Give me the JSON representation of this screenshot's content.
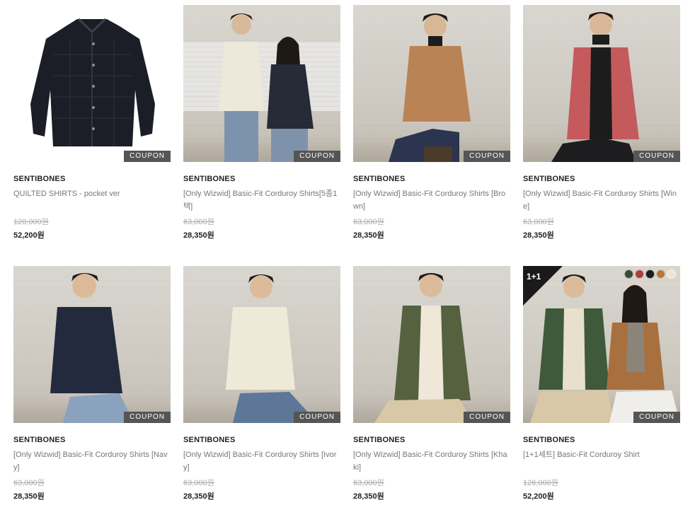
{
  "products": [
    {
      "brand": "SENTIBONES",
      "name": "QUILTED SHIRTS - pocket ver",
      "original_price": "120,000원",
      "sale_price": "52,200원",
      "coupon": "COUPON",
      "image": "quilted-shirt-flatlay",
      "colors": {
        "shirt": "#1b1e26"
      }
    },
    {
      "brand": "SENTIBONES",
      "name": "[Only Wizwid] Basic-Fit Corduroy Shirts[5종1택]",
      "original_price": "63,000원",
      "sale_price": "28,350원",
      "coupon": "COUPON",
      "image": "couple-models-photo",
      "colors": {
        "shirt": "#ece9da",
        "shirt2": "#262b38"
      }
    },
    {
      "brand": "SENTIBONES",
      "name": "[Only Wizwid] Basic-Fit Corduroy Shirts [Brown]",
      "original_price": "63,000원",
      "sale_price": "28,350원",
      "coupon": "COUPON",
      "image": "model-brown-shirt-photo",
      "colors": {
        "shirt": "#b98355"
      }
    },
    {
      "brand": "SENTIBONES",
      "name": "[Only Wizwid] Basic-Fit Corduroy Shirts [Wine]",
      "original_price": "63,000원",
      "sale_price": "28,350원",
      "coupon": "COUPON",
      "image": "model-wine-shirt-photo",
      "colors": {
        "shirt": "#c45a5c"
      }
    },
    {
      "brand": "SENTIBONES",
      "name": "[Only Wizwid] Basic-Fit Corduroy Shirts [Navy]",
      "original_price": "63,000원",
      "sale_price": "28,350원",
      "coupon": "COUPON",
      "image": "model-navy-shirt-photo",
      "colors": {
        "shirt": "#242a3d"
      }
    },
    {
      "brand": "SENTIBONES",
      "name": "[Only Wizwid] Basic-Fit Corduroy Shirts [Ivory]",
      "original_price": "63,000원",
      "sale_price": "28,350원",
      "coupon": "COUPON",
      "image": "model-ivory-shirt-photo",
      "colors": {
        "shirt": "#efead8"
      }
    },
    {
      "brand": "SENTIBONES",
      "name": "[Only Wizwid] Basic-Fit Corduroy Shirts [Khaki]",
      "original_price": "63,000원",
      "sale_price": "28,350원",
      "coupon": "COUPON",
      "image": "model-khaki-shirt-photo",
      "colors": {
        "shirt": "#55613f"
      }
    },
    {
      "brand": "SENTIBONES",
      "name": "[1+1세트] Basic-Fit Corduroy Shirt",
      "original_price": "126,000원",
      "sale_price": "52,200원",
      "coupon": "COUPON",
      "image": "couple-models-photo-set",
      "badge": "1+1",
      "swatches": [
        "#3a4a34",
        "#a8413d",
        "#1c1c1c",
        "#b5773f",
        "#ece6d4"
      ],
      "colors": {
        "shirt": "#3f5a3a",
        "shirt2": "#a9703f"
      }
    }
  ]
}
